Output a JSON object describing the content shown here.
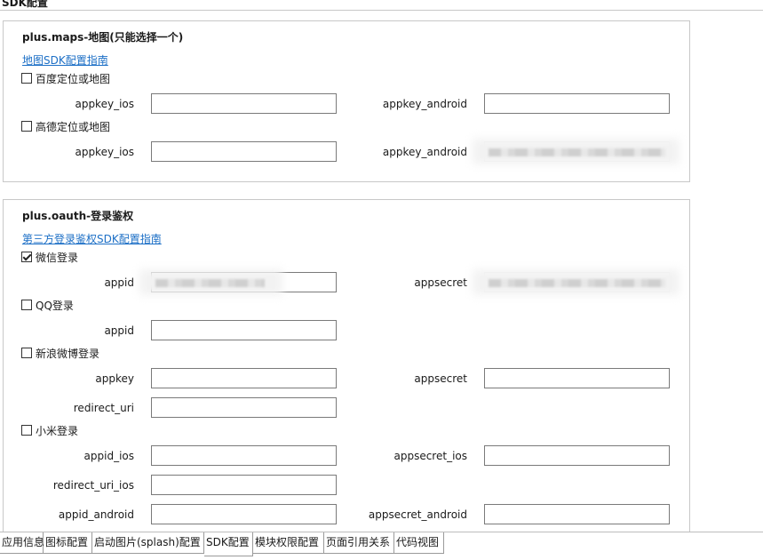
{
  "top_title": "SDK配置",
  "maps": {
    "title": "plus.maps-地图(只能选择一个)",
    "guide_link": "地图SDK配置指南",
    "providers": [
      {
        "label": "百度定位或地图",
        "checked": false,
        "fields": [
          {
            "label": "appkey_ios",
            "value": ""
          },
          {
            "label": "appkey_android",
            "value": ""
          }
        ]
      },
      {
        "label": "高德定位或地图",
        "checked": false,
        "fields": [
          {
            "label": "appkey_ios",
            "value": ""
          },
          {
            "label": "appkey_android",
            "value": ""
          }
        ]
      }
    ]
  },
  "oauth": {
    "title": "plus.oauth-登录鉴权",
    "guide_link": "第三方登录鉴权SDK配置指南",
    "providers": [
      {
        "label": "微信登录",
        "checked": true,
        "fields": [
          {
            "label": "appid",
            "value": ""
          },
          {
            "label": "appsecret",
            "value": ""
          }
        ]
      },
      {
        "label": "QQ登录",
        "checked": false,
        "fields": [
          {
            "label": "appid",
            "value": ""
          }
        ]
      },
      {
        "label": "新浪微博登录",
        "checked": false,
        "fields": [
          {
            "label": "appkey",
            "value": ""
          },
          {
            "label": "appsecret",
            "value": ""
          },
          {
            "label": "redirect_uri",
            "value": ""
          }
        ]
      },
      {
        "label": "小米登录",
        "checked": false,
        "fields": [
          {
            "label": "appid_ios",
            "value": ""
          },
          {
            "label": "appsecret_ios",
            "value": ""
          },
          {
            "label": "redirect_uri_ios",
            "value": ""
          },
          {
            "label": "appid_android",
            "value": ""
          },
          {
            "label": "appsecret_android",
            "value": ""
          }
        ]
      }
    ]
  },
  "tabs": [
    {
      "label": "应用信息"
    },
    {
      "label": "图标配置"
    },
    {
      "label": "启动图片(splash)配置"
    },
    {
      "label": "SDK配置",
      "active": true
    },
    {
      "label": "模块权限配置"
    },
    {
      "label": "页面引用关系"
    },
    {
      "label": "代码视图"
    }
  ]
}
